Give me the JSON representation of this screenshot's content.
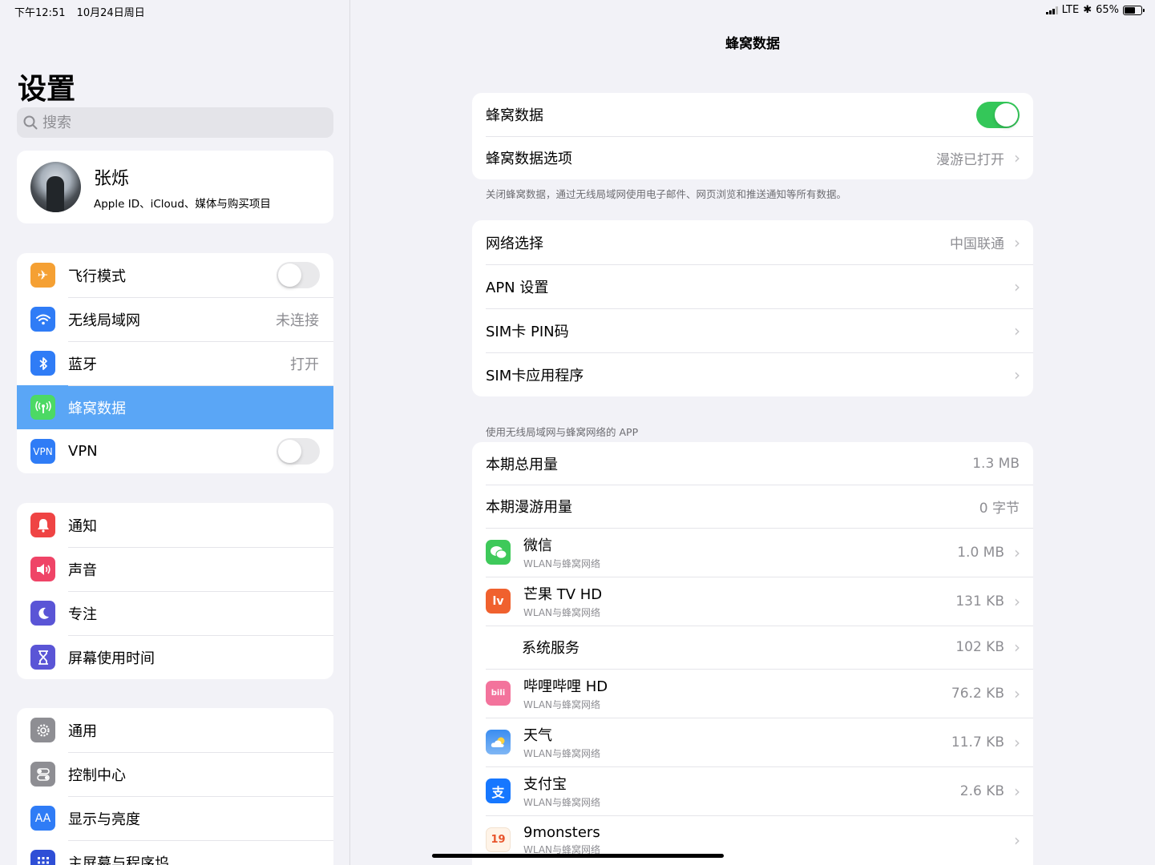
{
  "status_bar": {
    "time": "下午12:51",
    "date": "10月24日周日",
    "network": "LTE",
    "battery": "65%",
    "battery_level": 0.65
  },
  "sidebar": {
    "title": "设置",
    "search_placeholder": "搜索",
    "profile": {
      "name": "张烁",
      "subtitle": "Apple ID、iCloud、媒体与购买项目"
    },
    "group1": [
      {
        "label": "飞行模式",
        "icon": "airplane-icon",
        "color": "#f5a033",
        "toggle": false
      },
      {
        "label": "无线局域网",
        "icon": "wifi-icon",
        "color": "#2f7cf6",
        "value": "未连接"
      },
      {
        "label": "蓝牙",
        "icon": "bluetooth-icon",
        "color": "#2f7cf6",
        "value": "打开"
      },
      {
        "label": "蜂窝数据",
        "icon": "cellular-icon",
        "color": "#4cd964",
        "selected": true
      },
      {
        "label": "VPN",
        "icon": "vpn-icon",
        "color": "#2f7cf6",
        "toggle": false
      }
    ],
    "group2": [
      {
        "label": "通知",
        "icon": "notification-icon",
        "color": "#ef4444"
      },
      {
        "label": "声音",
        "icon": "sound-icon",
        "color": "#ef4467"
      },
      {
        "label": "专注",
        "icon": "moon-icon",
        "color": "#5a55d6"
      },
      {
        "label": "屏幕使用时间",
        "icon": "hourglass-icon",
        "color": "#5a55d6"
      }
    ],
    "group3": [
      {
        "label": "通用",
        "icon": "gear-icon",
        "color": "#8e8e93"
      },
      {
        "label": "控制中心",
        "icon": "control-center-icon",
        "color": "#8e8e93"
      },
      {
        "label": "显示与亮度",
        "icon": "display-icon",
        "color": "#2f7cf6"
      },
      {
        "label": "主屏幕与程序坞",
        "icon": "home-screen-icon",
        "color": "#2f4fd6"
      }
    ],
    "icon_glyphs": {
      "vpn": "VPN",
      "display": "AA"
    }
  },
  "main": {
    "title": "蜂窝数据",
    "group1": {
      "cellular_label": "蜂窝数据",
      "cellular_on": true,
      "options_label": "蜂窝数据选项",
      "options_value": "漫游已打开"
    },
    "footnote": "关闭蜂窝数据，通过无线局域网使用电子邮件、网页浏览和推送通知等所有数据。",
    "group2": [
      {
        "label": "网络选择",
        "value": "中国联通"
      },
      {
        "label": "APN 设置",
        "value": ""
      },
      {
        "label": "SIM卡 PIN码",
        "value": ""
      },
      {
        "label": "SIM卡应用程序",
        "value": ""
      }
    ],
    "apps_header": "使用无线局域网与蜂窝网络的 APP",
    "usage": {
      "total_label": "本期总用量",
      "total_value": "1.3 MB",
      "roaming_label": "本期漫游用量",
      "roaming_value": "0 字节"
    },
    "apps": [
      {
        "name": "微信",
        "sub": "WLAN与蜂窝网络",
        "value": "1.0 MB",
        "icon": "wechat-icon",
        "color": "#3ec95a"
      },
      {
        "name": "芒果 TV HD",
        "sub": "WLAN与蜂窝网络",
        "value": "131 KB",
        "icon": "mango-tv-icon",
        "color": "#f0612e"
      },
      {
        "name": "系统服务",
        "sub": "",
        "value": "102 KB",
        "icon": ""
      },
      {
        "name": "哔哩哔哩 HD",
        "sub": "WLAN与蜂窝网络",
        "value": "76.2 KB",
        "icon": "bilibili-icon",
        "color": "#f3739c"
      },
      {
        "name": "天气",
        "sub": "WLAN与蜂窝网络",
        "value": "11.7 KB",
        "icon": "weather-icon",
        "color": "#3b8df0"
      },
      {
        "name": "支付宝",
        "sub": "WLAN与蜂窝网络",
        "value": "2.6 KB",
        "icon": "alipay-icon",
        "color": "#1677ff"
      },
      {
        "name": "9monsters",
        "sub": "WLAN与蜂窝网络",
        "value": "",
        "icon": "9monsters-icon",
        "color": "#fff4e8"
      }
    ],
    "app_glyphs": {
      "mango": "lv",
      "bilibili": "bili",
      "alipay": "支",
      "monsters": "19"
    }
  }
}
